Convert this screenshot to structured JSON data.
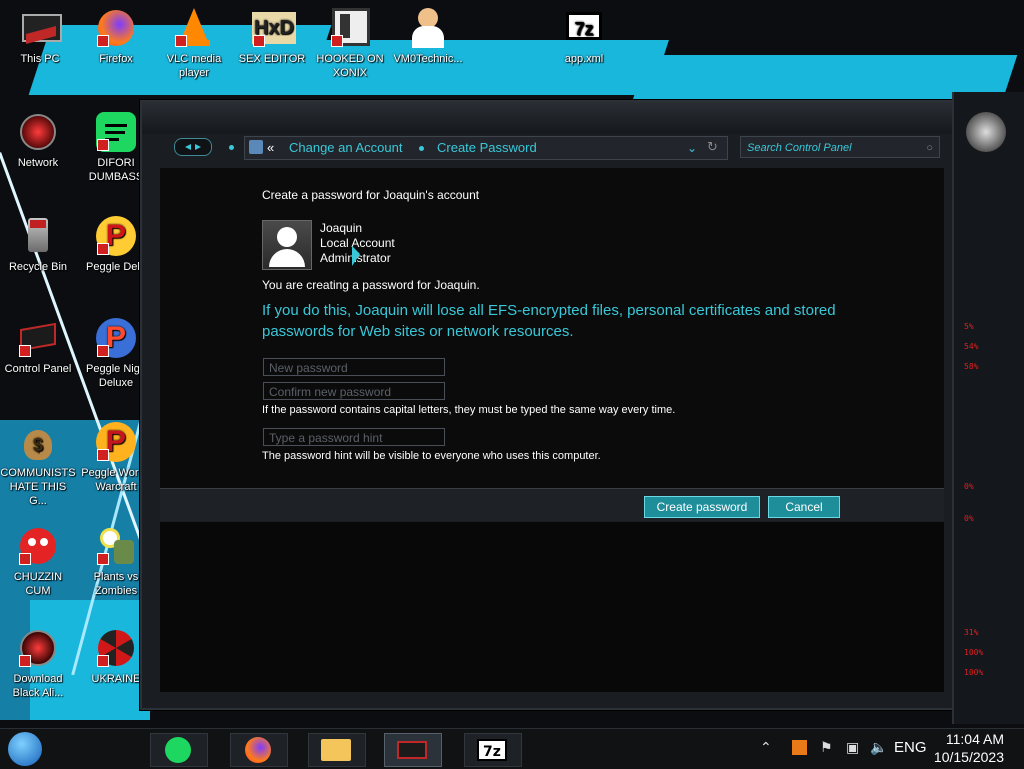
{
  "desktop": {
    "icons": [
      {
        "label": "This PC",
        "icon": "this-pc-icon"
      },
      {
        "label": "Firefox",
        "icon": "firefox-icon"
      },
      {
        "label": "VLC media player",
        "icon": "vlc-icon"
      },
      {
        "label": "SEX EDITOR",
        "icon": "hex-editor-icon"
      },
      {
        "label": "HOOKED ON XONIX",
        "icon": "game-icon"
      },
      {
        "label": "VM0Technic...",
        "icon": "doctor-icon"
      },
      {
        "label": "app.xml",
        "icon": "7zip-icon"
      },
      {
        "label": "Network",
        "icon": "network-icon"
      },
      {
        "label": "DIFORI DUMBASS",
        "icon": "spotify-icon"
      },
      {
        "label": "Recycle Bin",
        "icon": "recycle-bin-icon"
      },
      {
        "label": "Peggle Delu",
        "icon": "peggle-icon"
      },
      {
        "label": "Control Panel",
        "icon": "control-panel-icon"
      },
      {
        "label": "Peggle Nigh Deluxe",
        "icon": "peggle-icon"
      },
      {
        "label": "COMMUNISTS HATE THIS G...",
        "icon": "money-bag-icon"
      },
      {
        "label": "Peggle Wor of Warcraft",
        "icon": "peggle-icon"
      },
      {
        "label": "CHUZZIN CUM",
        "icon": "chuzzle-icon"
      },
      {
        "label": "Plants vs Zombies",
        "icon": "pvz-icon"
      },
      {
        "label": "Download Black Ali...",
        "icon": "alien-icon"
      },
      {
        "label": "UKRAINE",
        "icon": "radiation-icon"
      }
    ]
  },
  "window": {
    "breadcrumb": {
      "back_glyph": "«",
      "items": [
        "Change an Account",
        "Create Password"
      ]
    },
    "search_placeholder": "Search Control Panel",
    "heading": "Create a password for Joaquin's account",
    "account": {
      "name": "Joaquin",
      "type": "Local Account",
      "role": "Administrator"
    },
    "info_text": "You are creating a password for Joaquin.",
    "warning_text": "If you do this, Joaquin will lose all EFS-encrypted files, personal certificates and stored passwords for Web sites or network resources.",
    "fields": {
      "new_password_placeholder": "New password",
      "confirm_password_placeholder": "Confirm new password",
      "hint_placeholder": "Type a password hint"
    },
    "capital_note": "If the password contains capital letters, they must be typed the same way every time.",
    "hint_note": "The password hint will be visible to everyone who uses this computer.",
    "buttons": {
      "create": "Create password",
      "cancel": "Cancel"
    }
  },
  "gadget": {
    "items": [
      "5%",
      "54%",
      "58%",
      "0%",
      "0%",
      "31%",
      "100%",
      "100%"
    ]
  },
  "taskbar": {
    "language": "ENG",
    "time": "11:04 AM",
    "date": "10/15/2023"
  },
  "colors": {
    "accent_cyan": "#39c8d8",
    "button_teal": "#1f8e9b",
    "gadget_red": "#e02020"
  }
}
